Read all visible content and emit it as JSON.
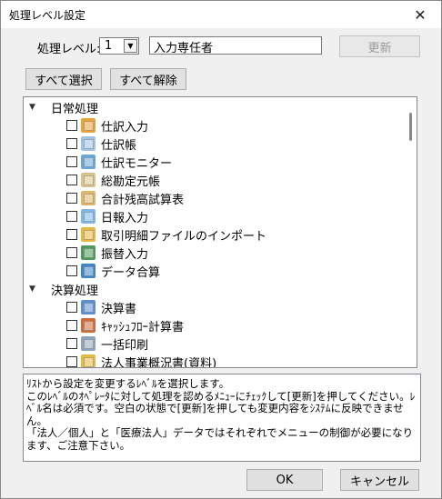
{
  "window": {
    "title": "処理レベル設定",
    "close_glyph": "✕"
  },
  "level": {
    "label": "処理レベル:",
    "value": "1",
    "name": "入力専任者",
    "update_label": "更新"
  },
  "buttons": {
    "select_all": "すべて選択",
    "deselect_all": "すべて解除",
    "ok": "OK",
    "cancel": "キャンセル"
  },
  "tree": {
    "groups": [
      {
        "label": "日常処理",
        "items": [
          {
            "label": "仕訳入力",
            "icon": "journal-entry-icon",
            "color": "#e8a33a"
          },
          {
            "label": "仕訳帳",
            "icon": "journal-book-icon",
            "color": "#9ec3e6"
          },
          {
            "label": "仕訳モニター",
            "icon": "journal-monitor-icon",
            "color": "#6aa6d8"
          },
          {
            "label": "総勘定元帳",
            "icon": "general-ledger-icon",
            "color": "#d8c48a"
          },
          {
            "label": "合計残高試算表",
            "icon": "trial-balance-icon",
            "color": "#e0b66a"
          },
          {
            "label": "日報入力",
            "icon": "daily-report-icon",
            "color": "#7fb7e8"
          },
          {
            "label": "取引明細ファイルのインポート",
            "icon": "import-icon",
            "color": "#e6b940"
          },
          {
            "label": "振替入力",
            "icon": "transfer-entry-icon",
            "color": "#4d9a5a"
          },
          {
            "label": "データ合算",
            "icon": "data-merge-icon",
            "color": "#3f85c9"
          }
        ]
      },
      {
        "label": "決算処理",
        "items": [
          {
            "label": "決算書",
            "icon": "financial-statement-icon",
            "color": "#5b8fcf"
          },
          {
            "label": "ｷｬｯｼｭﾌﾛｰ計算書",
            "icon": "cashflow-icon",
            "color": "#d06b3a"
          },
          {
            "label": "一括印刷",
            "icon": "printer-icon",
            "color": "#8fa4b8"
          },
          {
            "label": "法人事業概況書(資料)",
            "icon": "business-overview-icon",
            "color": "#e6b940"
          }
        ]
      }
    ]
  },
  "description": {
    "lines": [
      "ﾘｽﾄから設定を変更するﾚﾍﾞﾙを選択します。",
      "このﾚﾍﾞﾙのｵﾍﾟﾚｰﾀに対して処理を認めるﾒﾆｭｰにﾁｪｯｸして[更新]を押してください。ﾚﾍﾞﾙ名は必須です。空白の状態で[更新]を押しても変更内容をｼｽﾃﾑに反映できません。",
      "「法人／個人」と「医療法人」データではそれぞれでメニューの制御が必要になります、ご注意下さい。"
    ]
  }
}
